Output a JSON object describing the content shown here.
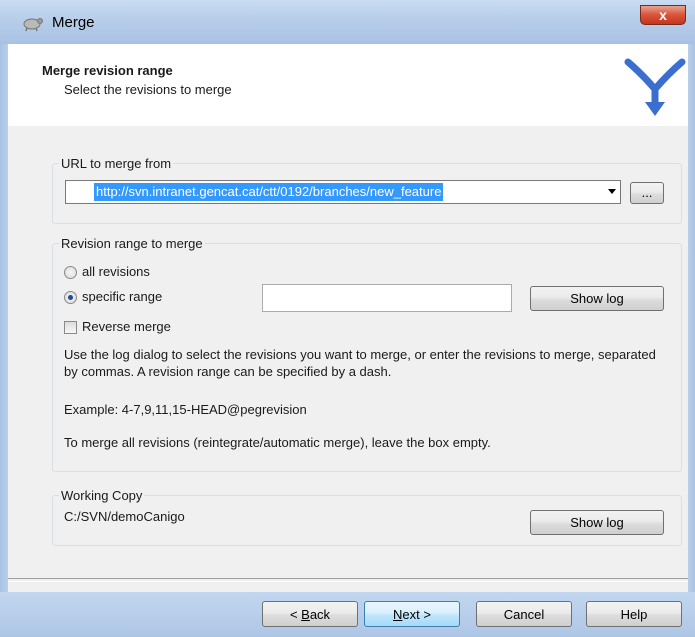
{
  "window": {
    "title": "Merge",
    "close_glyph": "x"
  },
  "header": {
    "title": "Merge revision range",
    "subtitle": "Select the revisions to merge",
    "logo_icon": "merge-arrows-icon",
    "logo_color": "#3a6fd0"
  },
  "url_group": {
    "legend": "URL to merge from",
    "value": "http://svn.intranet.gencat.cat/ctt/0192/branches/new_feature",
    "browse_label": "..."
  },
  "range_group": {
    "legend": "Revision range to merge",
    "all_revisions": "all revisions",
    "specific_range": "specific range",
    "selected": "specific_range",
    "range_value": "",
    "show_log": "Show log",
    "reverse_merge": "Reverse merge",
    "reverse_checked": false,
    "help1": "Use the log dialog to select the revisions you want to merge, or enter the revisions to merge, separated by commas. A revision range can be specified by a dash.",
    "help2": "Example: 4-7,9,11,15-HEAD@pegrevision",
    "help3": "To merge all revisions (reintegrate/automatic merge), leave the box empty."
  },
  "working_copy": {
    "legend": "Working Copy",
    "path": "C:/SVN/demoCanigo",
    "show_log": "Show log"
  },
  "footer": {
    "back": {
      "prefix": "< ",
      "accel": "B",
      "rest": "ack"
    },
    "next": {
      "accel": "N",
      "rest": "ext >"
    },
    "cancel": "Cancel",
    "help": "Help"
  }
}
